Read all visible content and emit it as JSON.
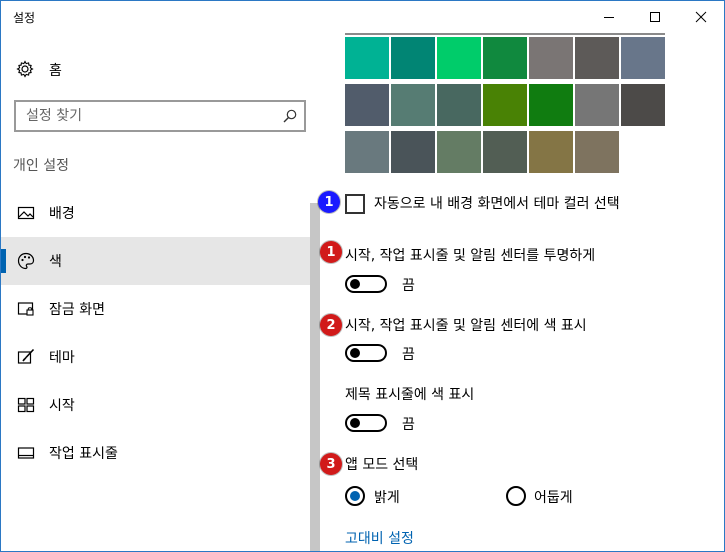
{
  "window": {
    "title": "설정"
  },
  "sidebar": {
    "home_label": "홈",
    "search_placeholder": "설정 찾기",
    "section_title": "개인 설정",
    "items": [
      {
        "label": "배경",
        "icon": "picture-icon"
      },
      {
        "label": "색",
        "icon": "palette-icon",
        "active": true
      },
      {
        "label": "잠금 화면",
        "icon": "lock-screen-icon"
      },
      {
        "label": "테마",
        "icon": "theme-brush-icon"
      },
      {
        "label": "시작",
        "icon": "start-grid-icon"
      },
      {
        "label": "작업 표시줄",
        "icon": "taskbar-icon"
      }
    ]
  },
  "colors": {
    "accent": "#0063b1",
    "swatches": [
      [
        "#00b294",
        "#018574",
        "#00cc6a",
        "#10893e",
        "#7a7574",
        "#5d5a58",
        "#68768a"
      ],
      [
        "#515c6b",
        "#567c73",
        "#486860",
        "#498205",
        "#107c10",
        "#767676",
        "#4c4a48"
      ],
      [
        "#69797e",
        "#4a5459",
        "#647c64",
        "#525e54",
        "#847545",
        "#7e735f"
      ]
    ]
  },
  "main": {
    "markers": [
      {
        "text": "1",
        "color": "#1a1aff"
      },
      {
        "text": "1",
        "color": "#d11a1a"
      },
      {
        "text": "2",
        "color": "#d11a1a"
      },
      {
        "text": "3",
        "color": "#d11a1a"
      }
    ],
    "auto_color_label": "자동으로 내 배경 화면에서 테마 컬러 선택",
    "transparency": {
      "label": "시작, 작업 표시줄 및 알림 센터를 투명하게",
      "state": "끔"
    },
    "show_color_start": {
      "label": "시작, 작업 표시줄 및 알림 센터에 색 표시",
      "state": "끔"
    },
    "show_color_title": {
      "label": "제목 표시줄에 색 표시",
      "state": "끔"
    },
    "app_mode": {
      "label": "앱 모드 선택",
      "options": [
        {
          "label": "밝게",
          "selected": true
        },
        {
          "label": "어둡게",
          "selected": false
        }
      ]
    },
    "high_contrast_link": "고대비 설정"
  }
}
